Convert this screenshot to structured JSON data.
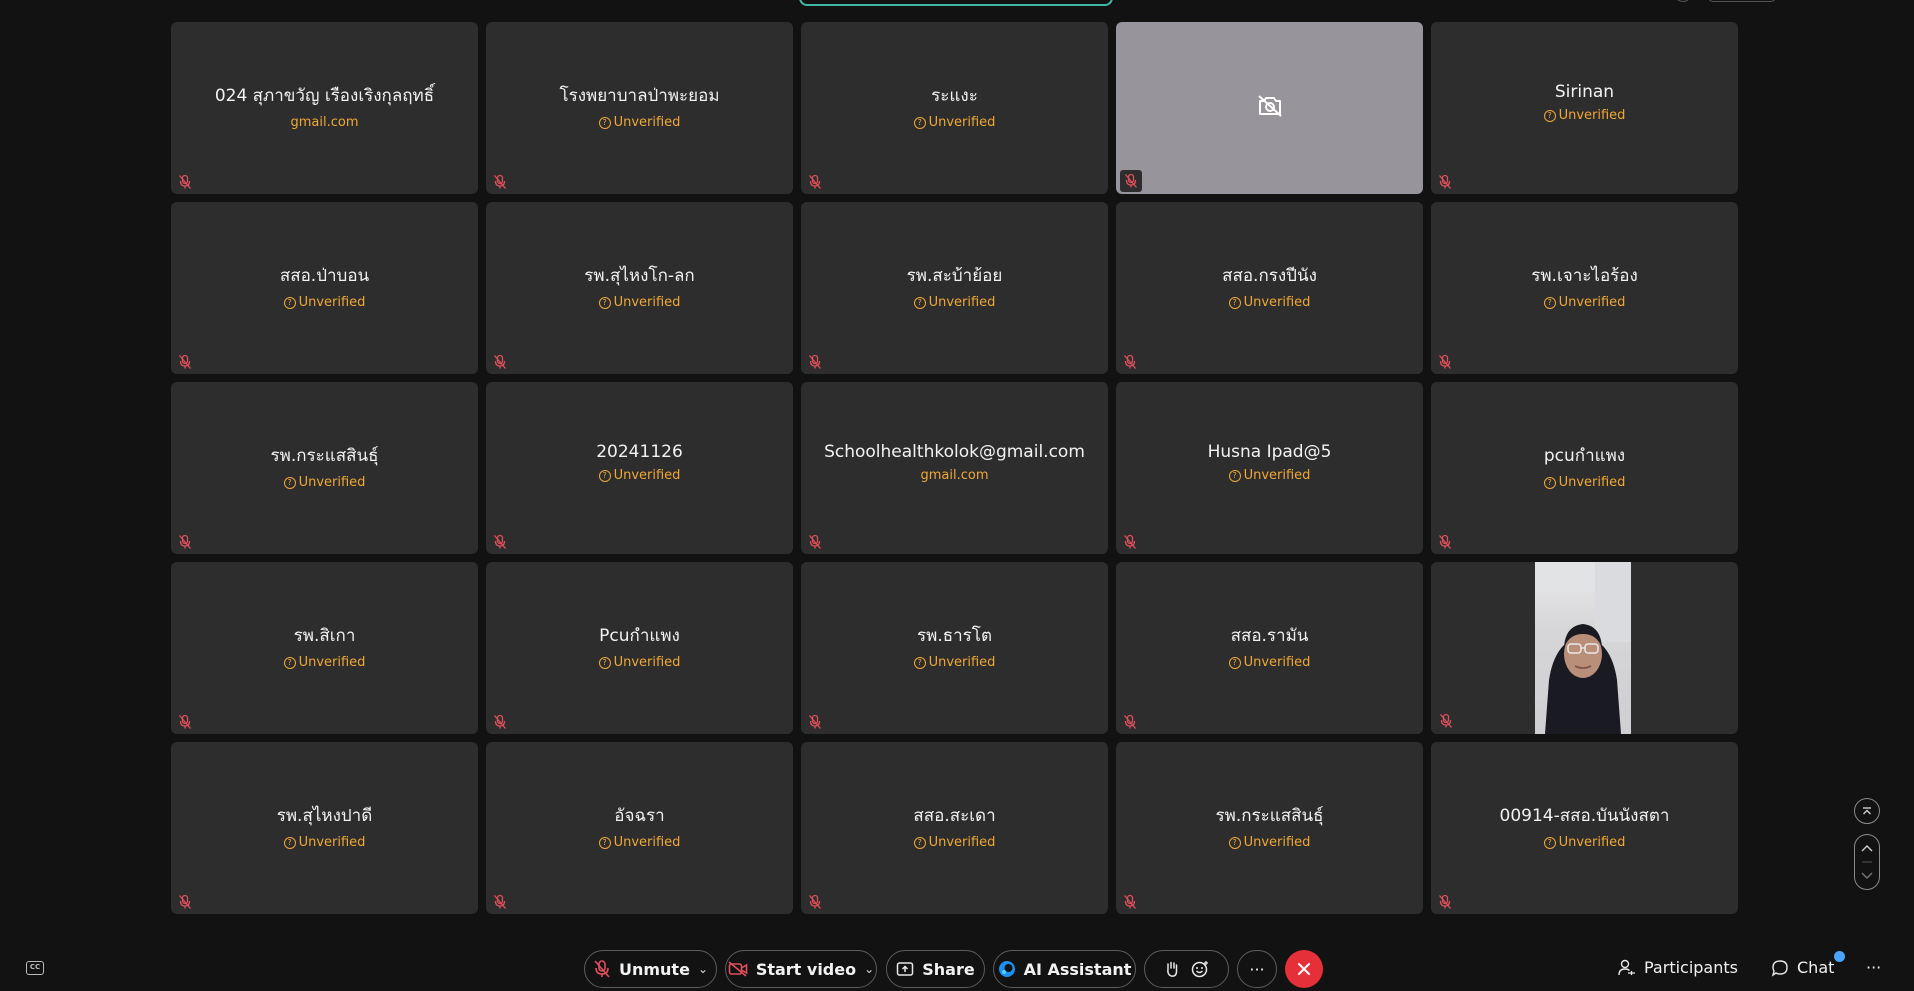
{
  "participants": [
    {
      "name": "024 สุภาขวัญ เรืองเริงกุลฤทธิ์",
      "status": "gmail.com",
      "verified_icon": false,
      "tile": "name"
    },
    {
      "name": "โรงพยาบาลป่าพะยอม",
      "status": "Unverified",
      "verified_icon": true,
      "tile": "name"
    },
    {
      "name": "ระแงะ",
      "status": "Unverified",
      "verified_icon": true,
      "tile": "name"
    },
    {
      "name": "",
      "status": "",
      "verified_icon": false,
      "tile": "camera-off"
    },
    {
      "name": "Sirinan",
      "status": "Unverified",
      "verified_icon": true,
      "tile": "name"
    },
    {
      "name": "สสอ.ป่าบอน",
      "status": "Unverified",
      "verified_icon": true,
      "tile": "name"
    },
    {
      "name": "รพ.สุไหงโก-ลก",
      "status": "Unverified",
      "verified_icon": true,
      "tile": "name"
    },
    {
      "name": "รพ.สะบ้าย้อย",
      "status": "Unverified",
      "verified_icon": true,
      "tile": "name"
    },
    {
      "name": "สสอ.กรงปีนัง",
      "status": "Unverified",
      "verified_icon": true,
      "tile": "name"
    },
    {
      "name": "รพ.เจาะไอร้อง",
      "status": "Unverified",
      "verified_icon": true,
      "tile": "name"
    },
    {
      "name": "รพ.กระแสสินธุ์",
      "status": "Unverified",
      "verified_icon": true,
      "tile": "name"
    },
    {
      "name": "20241126",
      "status": "Unverified",
      "verified_icon": true,
      "tile": "name"
    },
    {
      "name": "Schoolhealthkolok@gmail.com",
      "status": "gmail.com",
      "verified_icon": false,
      "tile": "name"
    },
    {
      "name": "Husna Ipad@5",
      "status": "Unverified",
      "verified_icon": true,
      "tile": "name"
    },
    {
      "name": "pcuกำแพง",
      "status": "Unverified",
      "verified_icon": true,
      "tile": "name"
    },
    {
      "name": "รพ.สิเกา",
      "status": "Unverified",
      "verified_icon": true,
      "tile": "name"
    },
    {
      "name": "Pcuกำแพง",
      "status": "Unverified",
      "verified_icon": true,
      "tile": "name"
    },
    {
      "name": "รพ.ธารโต",
      "status": "Unverified",
      "verified_icon": true,
      "tile": "name"
    },
    {
      "name": "สสอ.รามัน",
      "status": "Unverified",
      "verified_icon": true,
      "tile": "name"
    },
    {
      "name": "",
      "status": "",
      "verified_icon": false,
      "tile": "video"
    },
    {
      "name": "รพ.สุไหงปาดี",
      "status": "Unverified",
      "verified_icon": true,
      "tile": "name"
    },
    {
      "name": "อัจฉรา",
      "status": "Unverified",
      "verified_icon": true,
      "tile": "name"
    },
    {
      "name": "สสอ.สะเดา",
      "status": "Unverified",
      "verified_icon": true,
      "tile": "name"
    },
    {
      "name": "รพ.กระแสสินธุ์",
      "status": "Unverified",
      "verified_icon": true,
      "tile": "name"
    },
    {
      "name": "00914-สสอ.บันนังสตา",
      "status": "Unverified",
      "verified_icon": true,
      "tile": "name"
    }
  ],
  "toolbar": {
    "cc_label": "CC",
    "unmute": "Unmute",
    "start_video": "Start video",
    "share": "Share",
    "ai_assistant": "AI Assistant",
    "more": "···",
    "participants": "Participants",
    "chat": "Chat",
    "overflow": "···"
  },
  "icons": {
    "mic_muted": "mic-muted-icon",
    "camera_off": "camera-off-icon",
    "unverified": "question-circle-icon"
  },
  "colors": {
    "tile_bg": "#2d2d2d",
    "unverified": "#f0a836",
    "end_call": "#e5303a",
    "muted_red": "#e0505a",
    "chat_badge": "#4aa3ff"
  }
}
